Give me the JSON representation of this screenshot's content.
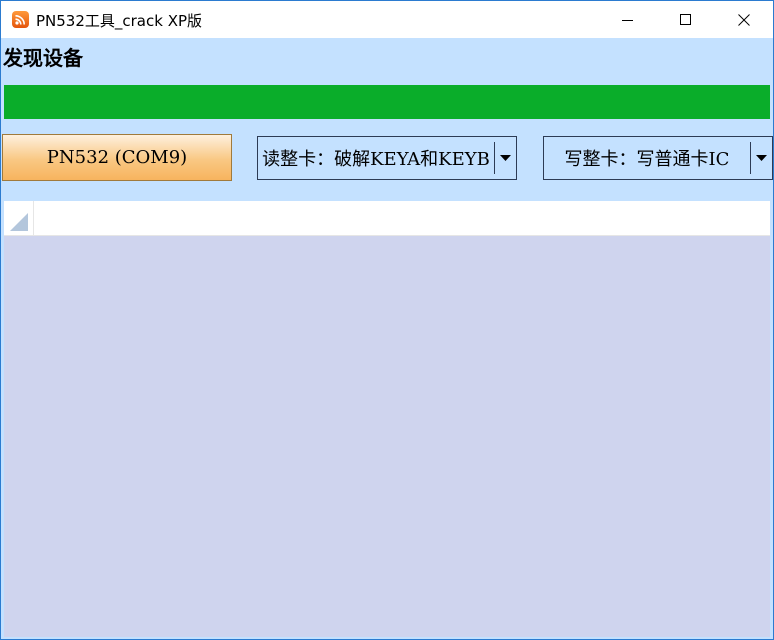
{
  "window": {
    "title": "PN532工具_crack XP版",
    "app_icon": "rss-icon",
    "controls": {
      "minimize_icon": "minimize-icon",
      "maximize_icon": "maximize-icon",
      "close_icon": "close-icon"
    }
  },
  "status": {
    "label": "发现设备",
    "progress_percent": 100,
    "progress_color": "#0aad2a"
  },
  "toolbar": {
    "device_button_label": "PN532 (COM9)",
    "read_mode": {
      "selected": "读整卡：破解KEYA和KEYB",
      "icon": "chevron-down-icon"
    },
    "write_mode": {
      "selected": "写整卡：写普通卡IC",
      "icon": "chevron-down-icon"
    }
  },
  "data_grid": {
    "corner_icon": "select-all-corner-icon",
    "background_color": "#cfd4ee"
  }
}
